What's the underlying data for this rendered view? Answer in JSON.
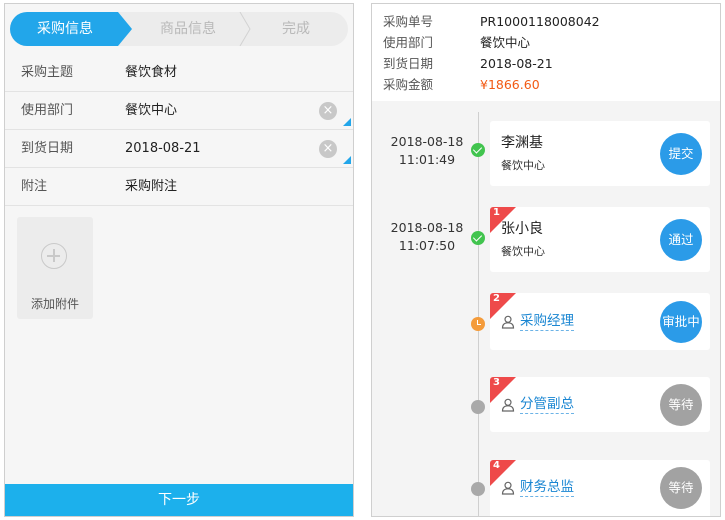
{
  "left": {
    "stepper": {
      "steps": [
        {
          "label": "采购信息",
          "active": true
        },
        {
          "label": "商品信息",
          "active": false
        },
        {
          "label": "完成",
          "active": false
        }
      ]
    },
    "form": {
      "subject": {
        "label": "采购主题",
        "value": "餐饮食材"
      },
      "department": {
        "label": "使用部门",
        "value": "餐饮中心"
      },
      "delivery_date": {
        "label": "到货日期",
        "value": "2018-08-21"
      },
      "note": {
        "label": "附注",
        "value": "采购附注"
      }
    },
    "attachment": {
      "label": "添加附件",
      "icon": "plus-circle-icon"
    },
    "next_button": {
      "label": "下一步"
    }
  },
  "right": {
    "info": {
      "order_no": {
        "label": "采购单号",
        "value": "PR1000118008042"
      },
      "department": {
        "label": "使用部门",
        "value": "餐饮中心"
      },
      "delivery_date": {
        "label": "到货日期",
        "value": "2018-08-21"
      },
      "amount": {
        "label": "采购金额",
        "value": "¥1866.60"
      }
    },
    "timeline": [
      {
        "date": "2018-08-18",
        "time": "11:01:49",
        "status": "done",
        "step": "",
        "name": "李渊基",
        "dept": "餐饮中心",
        "action": "提交"
      },
      {
        "date": "2018-08-18",
        "time": "11:07:50",
        "status": "done",
        "step": "1",
        "name": "张小良",
        "dept": "餐饮中心",
        "action": "通过"
      },
      {
        "date": "",
        "time": "",
        "status": "pending",
        "step": "2",
        "role": "采购经理",
        "action": "审批中"
      },
      {
        "date": "",
        "time": "",
        "status": "wait",
        "step": "3",
        "role": "分管副总",
        "action": "等待"
      },
      {
        "date": "",
        "time": "",
        "status": "wait",
        "step": "4",
        "role": "财务总监",
        "action": "等待"
      }
    ]
  },
  "colors": {
    "accent": "#22a6ea",
    "next_button": "#1cb0ec",
    "amount": "#f25a14",
    "done": "#41c44e",
    "pending": "#f49b3a",
    "wait": "#a9a9a9",
    "ribbon": "#ee4a4a"
  }
}
